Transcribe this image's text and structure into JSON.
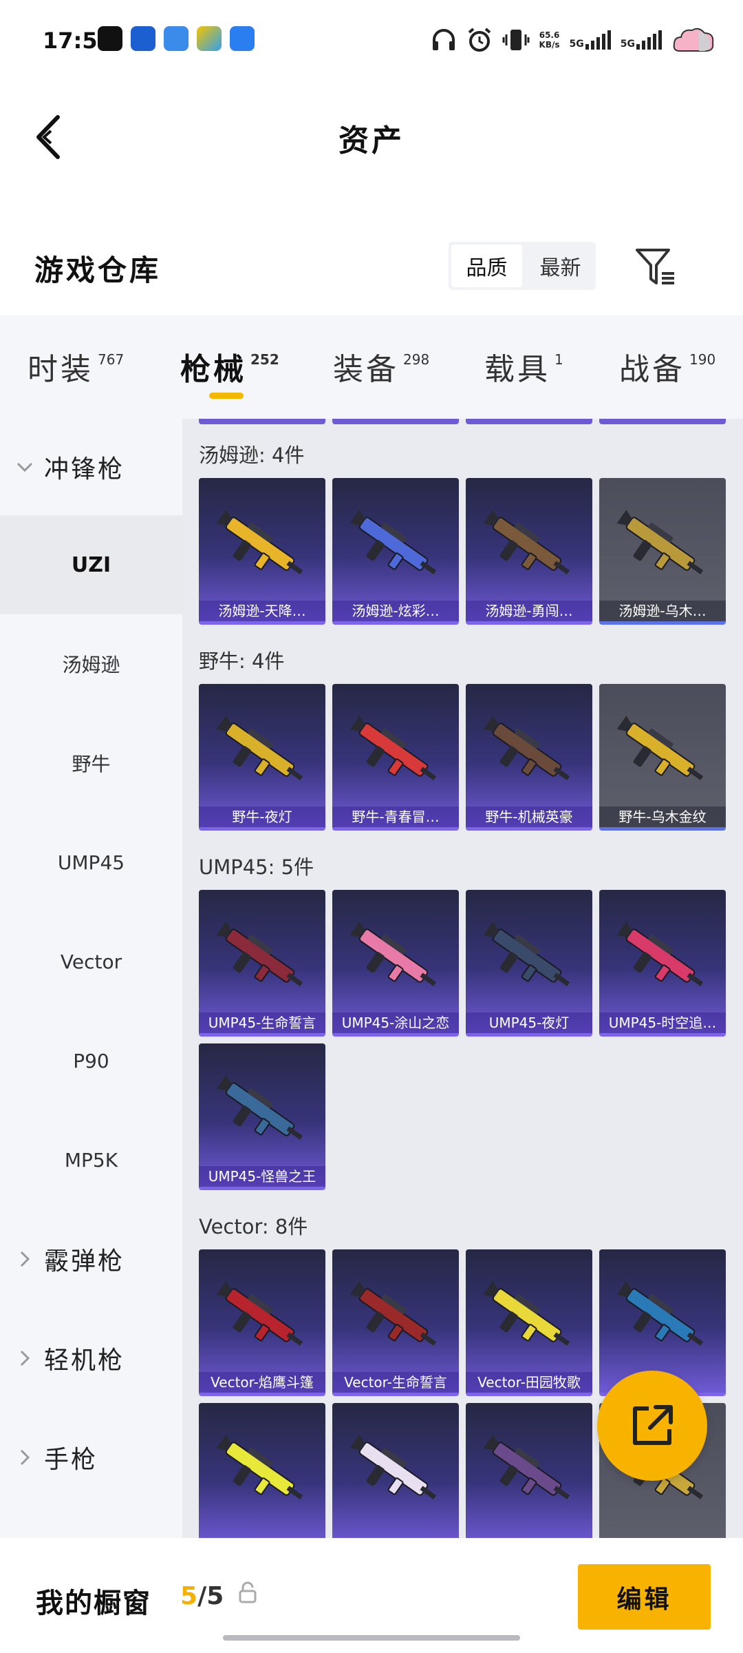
{
  "status_bar": {
    "time": "17:55",
    "net_speed_value": "65.6",
    "net_speed_unit": "KB/s",
    "sim1": "5G",
    "sim2": "5G"
  },
  "header": {
    "title": "资产"
  },
  "warehouse": {
    "title": "游戏仓库",
    "sort_options": [
      "品质",
      "最新"
    ],
    "active_sort": "品质"
  },
  "tabs": [
    {
      "label": "时装",
      "count": "767"
    },
    {
      "label": "枪械",
      "count": "252",
      "active": true
    },
    {
      "label": "装备",
      "count": "298"
    },
    {
      "label": "载具",
      "count": "1"
    },
    {
      "label": "战备",
      "count": "190"
    }
  ],
  "sidebar": {
    "smg": "冲锋枪",
    "sub": [
      "UZI",
      "汤姆逊",
      "野牛",
      "UMP45",
      "Vector",
      "P90",
      "MP5K"
    ],
    "active_sub": "UZI",
    "shotgun": "霰弹枪",
    "lmg": "轻机枪",
    "pistol": "手枪"
  },
  "sections": [
    {
      "title": "汤姆逊: 4件",
      "items": [
        {
          "name": "汤姆逊-天降…",
          "color": "#e8b52a"
        },
        {
          "name": "汤姆逊-炫彩…",
          "color": "#4e6ad8"
        },
        {
          "name": "汤姆逊-勇闯…",
          "color": "#7a5a3a"
        },
        {
          "name": "汤姆逊-乌木…",
          "color": "#b89a3a",
          "grey": true
        }
      ]
    },
    {
      "title": "野牛: 4件",
      "items": [
        {
          "name": "野牛-夜灯",
          "color": "#d8b02a"
        },
        {
          "name": "野牛-青春冒…",
          "color": "#d83a3a"
        },
        {
          "name": "野牛-机械英豪",
          "color": "#6a4a3a"
        },
        {
          "name": "野牛-乌木金纹",
          "color": "#d8b02a",
          "grey": true
        }
      ]
    },
    {
      "title": "UMP45: 5件",
      "items": [
        {
          "name": "UMP45-生命誓言",
          "color": "#8a2a3a"
        },
        {
          "name": "UMP45-涂山之恋",
          "color": "#e87aa8"
        },
        {
          "name": "UMP45-夜灯",
          "color": "#3a4a6a"
        },
        {
          "name": "UMP45-时空追…",
          "color": "#d83a6a"
        },
        {
          "name": "UMP45-怪兽之王",
          "color": "#3a6a9a"
        }
      ]
    },
    {
      "title": "Vector: 8件",
      "items": [
        {
          "name": "Vector-焰鹰斗篷",
          "color": "#b8242e"
        },
        {
          "name": "Vector-生命誓言",
          "color": "#9a2a2a"
        },
        {
          "name": "Vector-田园牧歌",
          "color": "#e8d83a"
        },
        {
          "name": "",
          "color": "#2a7ab8"
        },
        {
          "name": "",
          "color": "#e8e83a"
        },
        {
          "name": "",
          "color": "#e8e0f0"
        },
        {
          "name": "",
          "color": "#6a4a8a"
        },
        {
          "name": "",
          "color": "#c8a83a",
          "grey": true
        }
      ]
    }
  ],
  "bottom": {
    "showcase_label": "我的橱窗",
    "count_current": "5",
    "count_total": "/5",
    "edit_label": "编辑"
  }
}
